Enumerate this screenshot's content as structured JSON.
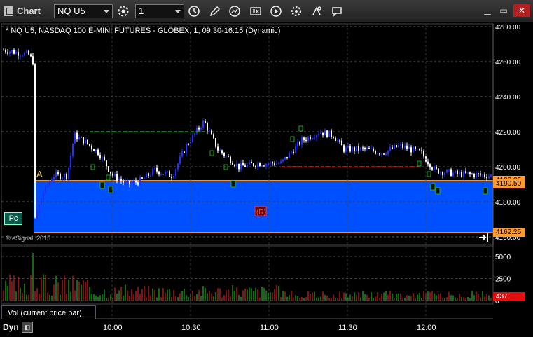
{
  "window": {
    "title": "Chart"
  },
  "toolbar": {
    "symbol": "NQ U5",
    "interval": "1"
  },
  "chart": {
    "info": "* NQ U5, NASDAQ 100 E-MINI FUTURES - GLOBEX, 1, 09:30-16:15 (Dynamic)",
    "copyright": "© eSignal, 2015",
    "price_axis": [
      "4280.00",
      "4260.00",
      "4240.00",
      "4220.00",
      "4200.00",
      "4180.00",
      "4160.00"
    ],
    "price_tags": {
      "upper": "4190.50",
      "lower": "4162.25",
      "hidden": "4190.25"
    },
    "time_axis": [
      "10:00",
      "10:30",
      "11:00",
      "11:30",
      "12:00"
    ],
    "box_label": "(R)",
    "a_label": "A",
    "pc_button": "Pc"
  },
  "volume": {
    "label": "Vol (current price bar)",
    "axis": [
      "5000",
      "2500",
      "0"
    ],
    "current": "437"
  },
  "status": {
    "mode": "Dyn"
  },
  "colors": {
    "blue_box": "#0050ff",
    "orange_line": "#ff8c1a",
    "up_bar": "#2030ff",
    "down_bar": "#ffffff",
    "vol_red": "#d02020",
    "vol_green": "#1bb01b"
  }
}
